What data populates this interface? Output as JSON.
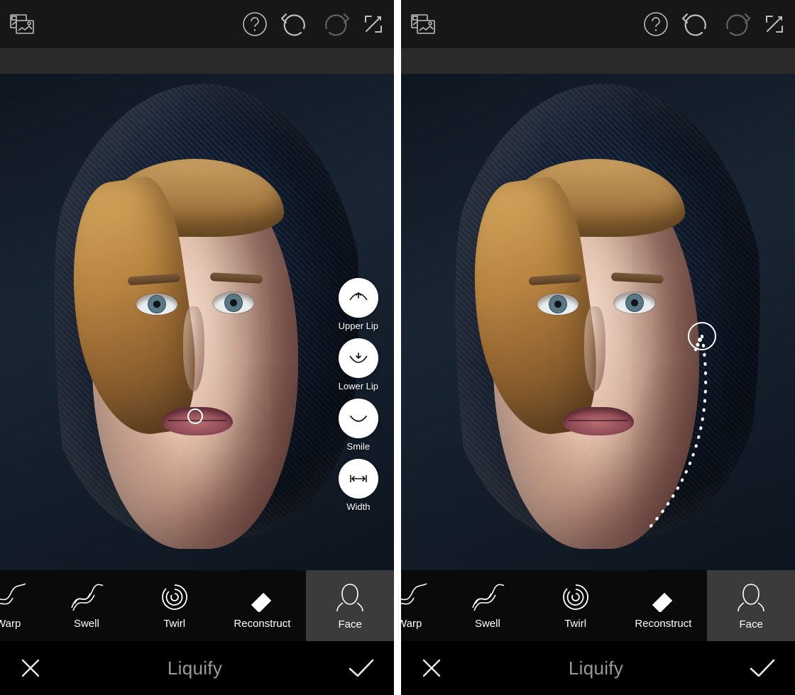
{
  "panes": {
    "left": {
      "radial": [
        {
          "label": "Upper Lip",
          "icon": "upper-lip-icon"
        },
        {
          "label": "Lower Lip",
          "icon": "lower-lip-icon"
        },
        {
          "label": "Smile",
          "icon": "smile-icon"
        },
        {
          "label": "Width",
          "icon": "width-icon"
        }
      ]
    },
    "right": {}
  },
  "tools": [
    {
      "label": "Warp",
      "icon": "warp-icon",
      "partial": true,
      "selected": false
    },
    {
      "label": "Swell",
      "icon": "swell-icon",
      "partial": false,
      "selected": false
    },
    {
      "label": "Twirl",
      "icon": "twirl-icon",
      "partial": false,
      "selected": false
    },
    {
      "label": "Reconstruct",
      "icon": "reconstruct-icon",
      "partial": false,
      "selected": false
    },
    {
      "label": "Face",
      "icon": "face-icon",
      "partial": false,
      "selected": true
    }
  ],
  "footer": {
    "title": "Liquify"
  }
}
